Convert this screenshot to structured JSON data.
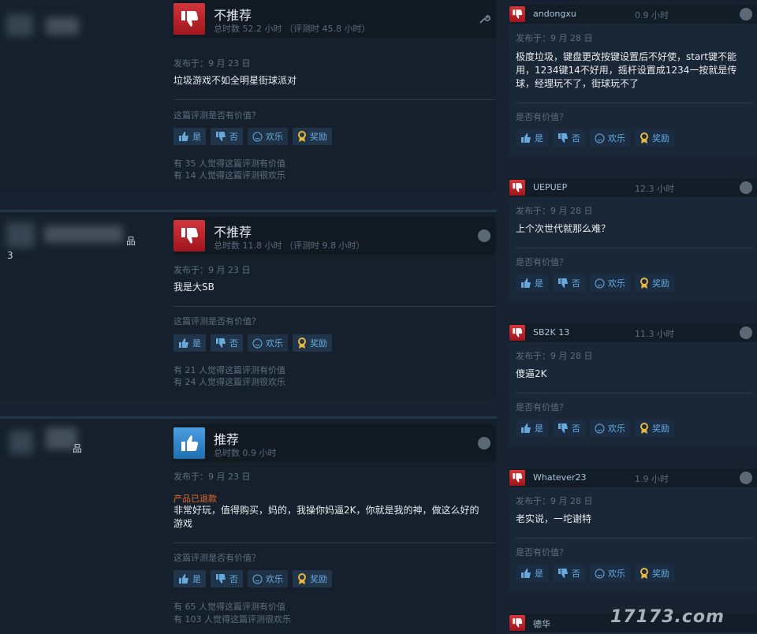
{
  "left_reviews": [
    {
      "verdict": "不推荐",
      "hours": "总时数 52.2 小时 （评测时 45.8 小时）",
      "posted": "发布于：9 月 23 日",
      "content": "垃圾游戏不如全明星街球派对",
      "helpful_q": "这篇评测是否有价值？",
      "stats": [
        "有 35 人觉得这篇评测有价值",
        "有 14 人觉得这篇评测很欢乐"
      ]
    },
    {
      "author_text": "品",
      "author_sub": "3",
      "verdict": "不推荐",
      "hours": "总时数 11.8 小时 （评测时 9.8 小时）",
      "posted": "发布于：9 月 23 日",
      "content": "我是大SB",
      "helpful_q": "这篇评测是否有价值？",
      "stats": [
        "有 21 人觉得这篇评测有价值",
        "有 24 人觉得这篇评测很欢乐"
      ]
    },
    {
      "author_text": "品",
      "verdict": "推荐",
      "hours": "总时数 0.9 小时",
      "posted": "发布于：9 月 23 日",
      "product_tag": "产品已退款",
      "content": "非常好玩，值得购买，妈的，我操你妈逼2K，你就是我的神，做这么好的游戏",
      "helpful_q": "这篇评测是否有价值？",
      "stats": [
        "有 65 人觉得这篇评测有价值",
        "有 103 人觉得这篇评测很欢乐"
      ]
    }
  ],
  "buttons": {
    "yes": "是",
    "no": "否",
    "funny": "欢乐",
    "award": "奖励"
  },
  "right_reviews": [
    {
      "name": "andongxu",
      "hours": "0.9 小时",
      "posted": "发布于：9 月 28 日",
      "content": "极度垃圾，键盘更改按键设置后不好使，start键不能用，1234键14不好用，摇杆设置成1234一按就是传球，经理玩不了，街球玩不了",
      "helpful_q": "是否有价值？"
    },
    {
      "name": "UEPUEP",
      "hours": "12.3 小时",
      "posted": "发布于：9 月 28 日",
      "content": "上个次世代就那么难？",
      "helpful_q": "是否有价值？"
    },
    {
      "name": "SB2K 13",
      "hours": "11.3 小时",
      "posted": "发布于：9 月 28 日",
      "content": "傻逼2K",
      "helpful_q": "是否有价值？"
    },
    {
      "name": "Whatever23",
      "hours": "1.9 小时",
      "posted": "发布于：9 月 28 日",
      "content": "老实说，一坨谢特",
      "helpful_q": "是否有价值？"
    },
    {
      "name": "德华"
    }
  ],
  "watermark": "17173.com",
  "colors": {
    "not_recommended": "#c4262c",
    "recommended": "#3a8ad3",
    "link": "#67a9dd",
    "refund": "#e46a2b"
  }
}
